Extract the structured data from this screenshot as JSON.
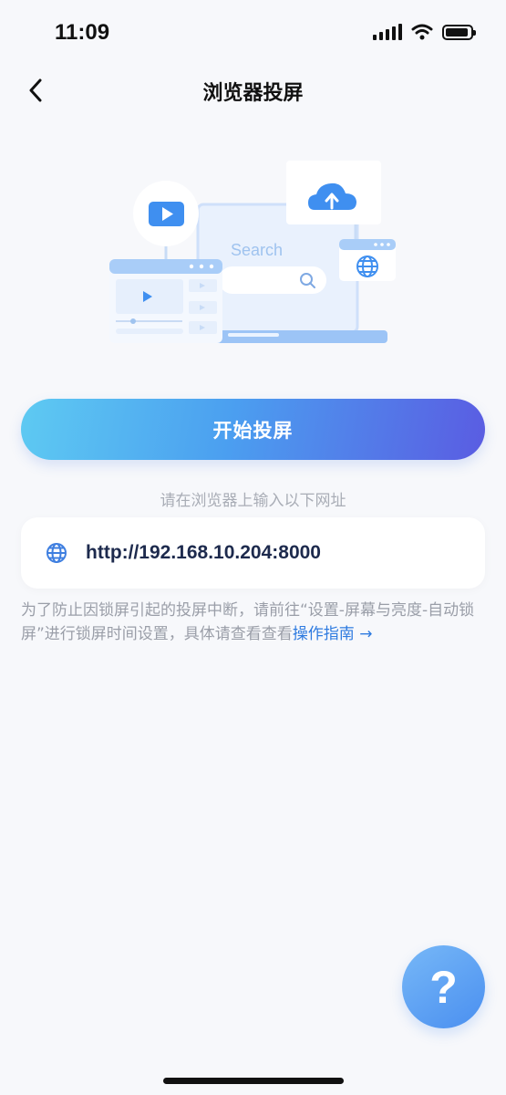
{
  "status_bar": {
    "time": "11:09"
  },
  "nav": {
    "title": "浏览器投屏",
    "back_icon": "chevron-left-icon"
  },
  "illustration": {
    "search_label": "Search"
  },
  "start_button_label": "开始投屏",
  "hint": "请在浏览器上输入以下网址",
  "url": {
    "value": "http://192.168.10.204:8000",
    "icon": "globe-icon"
  },
  "note": {
    "text": "为了防止因锁屏引起的投屏中断，请前往“设置-屏幕与亮度-自动锁屏”进行锁屏时间设置，具体请查看查看",
    "link": "操作指南",
    "arrow": "→"
  },
  "help_button": {
    "label": "?"
  },
  "colors": {
    "accent": "#4a8ff0",
    "link": "#2f7be0",
    "gradient_start": "#5ecaf2",
    "gradient_end": "#5a5ce2"
  }
}
